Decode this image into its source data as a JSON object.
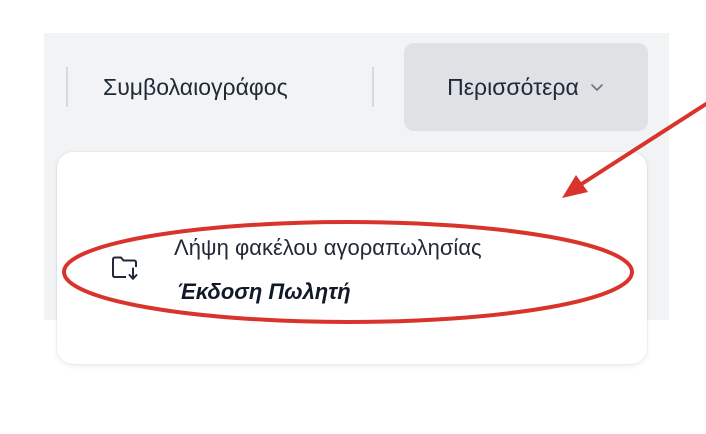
{
  "toolbar": {
    "notary_tab_label": "Συμβολαιογράφος",
    "more_button_label": "Περισσότερα"
  },
  "dropdown": {
    "items": [
      {
        "icon": "folder-download-icon",
        "label": "Λήψη φακέλου αγοραπωλησίας",
        "sublabel": "Έκδοση Πωλητή"
      }
    ]
  },
  "colors": {
    "annotation": "#d9342b",
    "toolbar_background": "#f2f3f5",
    "more_button_background": "#dfe1e5",
    "menu_background": "#ffffff",
    "text": "#1f2937"
  },
  "icons": {
    "more_chevron": "chevron-down-icon"
  }
}
